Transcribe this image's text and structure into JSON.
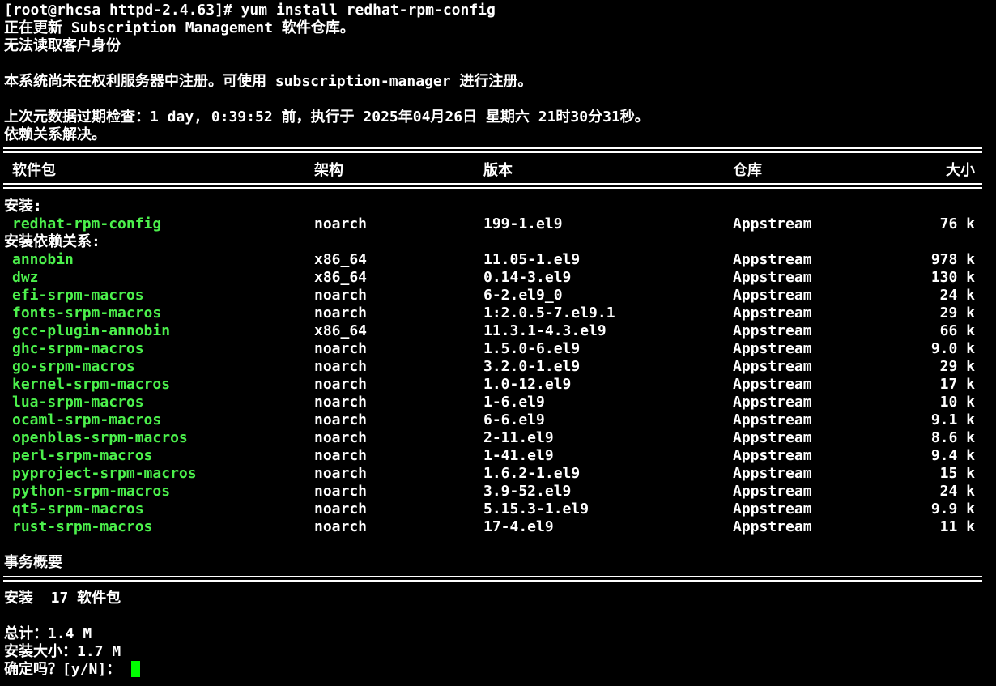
{
  "prompt": "[root@rhcsa httpd-2.4.63]# yum install redhat-rpm-config",
  "lines": {
    "updating": "正在更新 Subscription Management 软件仓库。",
    "no_identity": "无法读取客户身份",
    "not_registered": "本系统尚未在权利服务器中注册。可使用 subscription-manager 进行注册。",
    "metadata": "上次元数据过期检查：1 day, 0:39:52 前，执行于 2025年04月26日 星期六 21时30分31秒。",
    "resolved": "依赖关系解决。"
  },
  "table": {
    "headers": {
      "package": "软件包",
      "arch": "架构",
      "version": "版本",
      "repo": "仓库",
      "size": "大小"
    },
    "install_section": "安装:",
    "deps_section": "安装依赖关系:",
    "install_rows": [
      {
        "name": "redhat-rpm-config",
        "arch": "noarch",
        "version": "199-1.el9",
        "repo": "Appstream",
        "size": "76 k"
      }
    ],
    "dep_rows": [
      {
        "name": "annobin",
        "arch": "x86_64",
        "version": "11.05-1.el9",
        "repo": "Appstream",
        "size": "978 k"
      },
      {
        "name": "dwz",
        "arch": "x86_64",
        "version": "0.14-3.el9",
        "repo": "Appstream",
        "size": "130 k"
      },
      {
        "name": "efi-srpm-macros",
        "arch": "noarch",
        "version": "6-2.el9_0",
        "repo": "Appstream",
        "size": "24 k"
      },
      {
        "name": "fonts-srpm-macros",
        "arch": "noarch",
        "version": "1:2.0.5-7.el9.1",
        "repo": "Appstream",
        "size": "29 k"
      },
      {
        "name": "gcc-plugin-annobin",
        "arch": "x86_64",
        "version": "11.3.1-4.3.el9",
        "repo": "Appstream",
        "size": "66 k"
      },
      {
        "name": "ghc-srpm-macros",
        "arch": "noarch",
        "version": "1.5.0-6.el9",
        "repo": "Appstream",
        "size": "9.0 k"
      },
      {
        "name": "go-srpm-macros",
        "arch": "noarch",
        "version": "3.2.0-1.el9",
        "repo": "Appstream",
        "size": "29 k"
      },
      {
        "name": "kernel-srpm-macros",
        "arch": "noarch",
        "version": "1.0-12.el9",
        "repo": "Appstream",
        "size": "17 k"
      },
      {
        "name": "lua-srpm-macros",
        "arch": "noarch",
        "version": "1-6.el9",
        "repo": "Appstream",
        "size": "10 k"
      },
      {
        "name": "ocaml-srpm-macros",
        "arch": "noarch",
        "version": "6-6.el9",
        "repo": "Appstream",
        "size": "9.1 k"
      },
      {
        "name": "openblas-srpm-macros",
        "arch": "noarch",
        "version": "2-11.el9",
        "repo": "Appstream",
        "size": "8.6 k"
      },
      {
        "name": "perl-srpm-macros",
        "arch": "noarch",
        "version": "1-41.el9",
        "repo": "Appstream",
        "size": "9.4 k"
      },
      {
        "name": "pyproject-srpm-macros",
        "arch": "noarch",
        "version": "1.6.2-1.el9",
        "repo": "Appstream",
        "size": "15 k"
      },
      {
        "name": "python-srpm-macros",
        "arch": "noarch",
        "version": "3.9-52.el9",
        "repo": "Appstream",
        "size": "24 k"
      },
      {
        "name": "qt5-srpm-macros",
        "arch": "noarch",
        "version": "5.15.3-1.el9",
        "repo": "Appstream",
        "size": "9.9 k"
      },
      {
        "name": "rust-srpm-macros",
        "arch": "noarch",
        "version": "17-4.el9",
        "repo": "Appstream",
        "size": "11 k"
      }
    ]
  },
  "summary": {
    "title": "事务概要",
    "install_line": "安装  17 软件包",
    "total": "总计：1.4 M",
    "installed_size": "安装大小：1.7 M",
    "confirm_prompt": "确定吗？[y/N]： "
  },
  "colors": {
    "background": "#000000",
    "text": "#ffffff",
    "package": "#4cf04c",
    "cursor": "#00ff00"
  }
}
